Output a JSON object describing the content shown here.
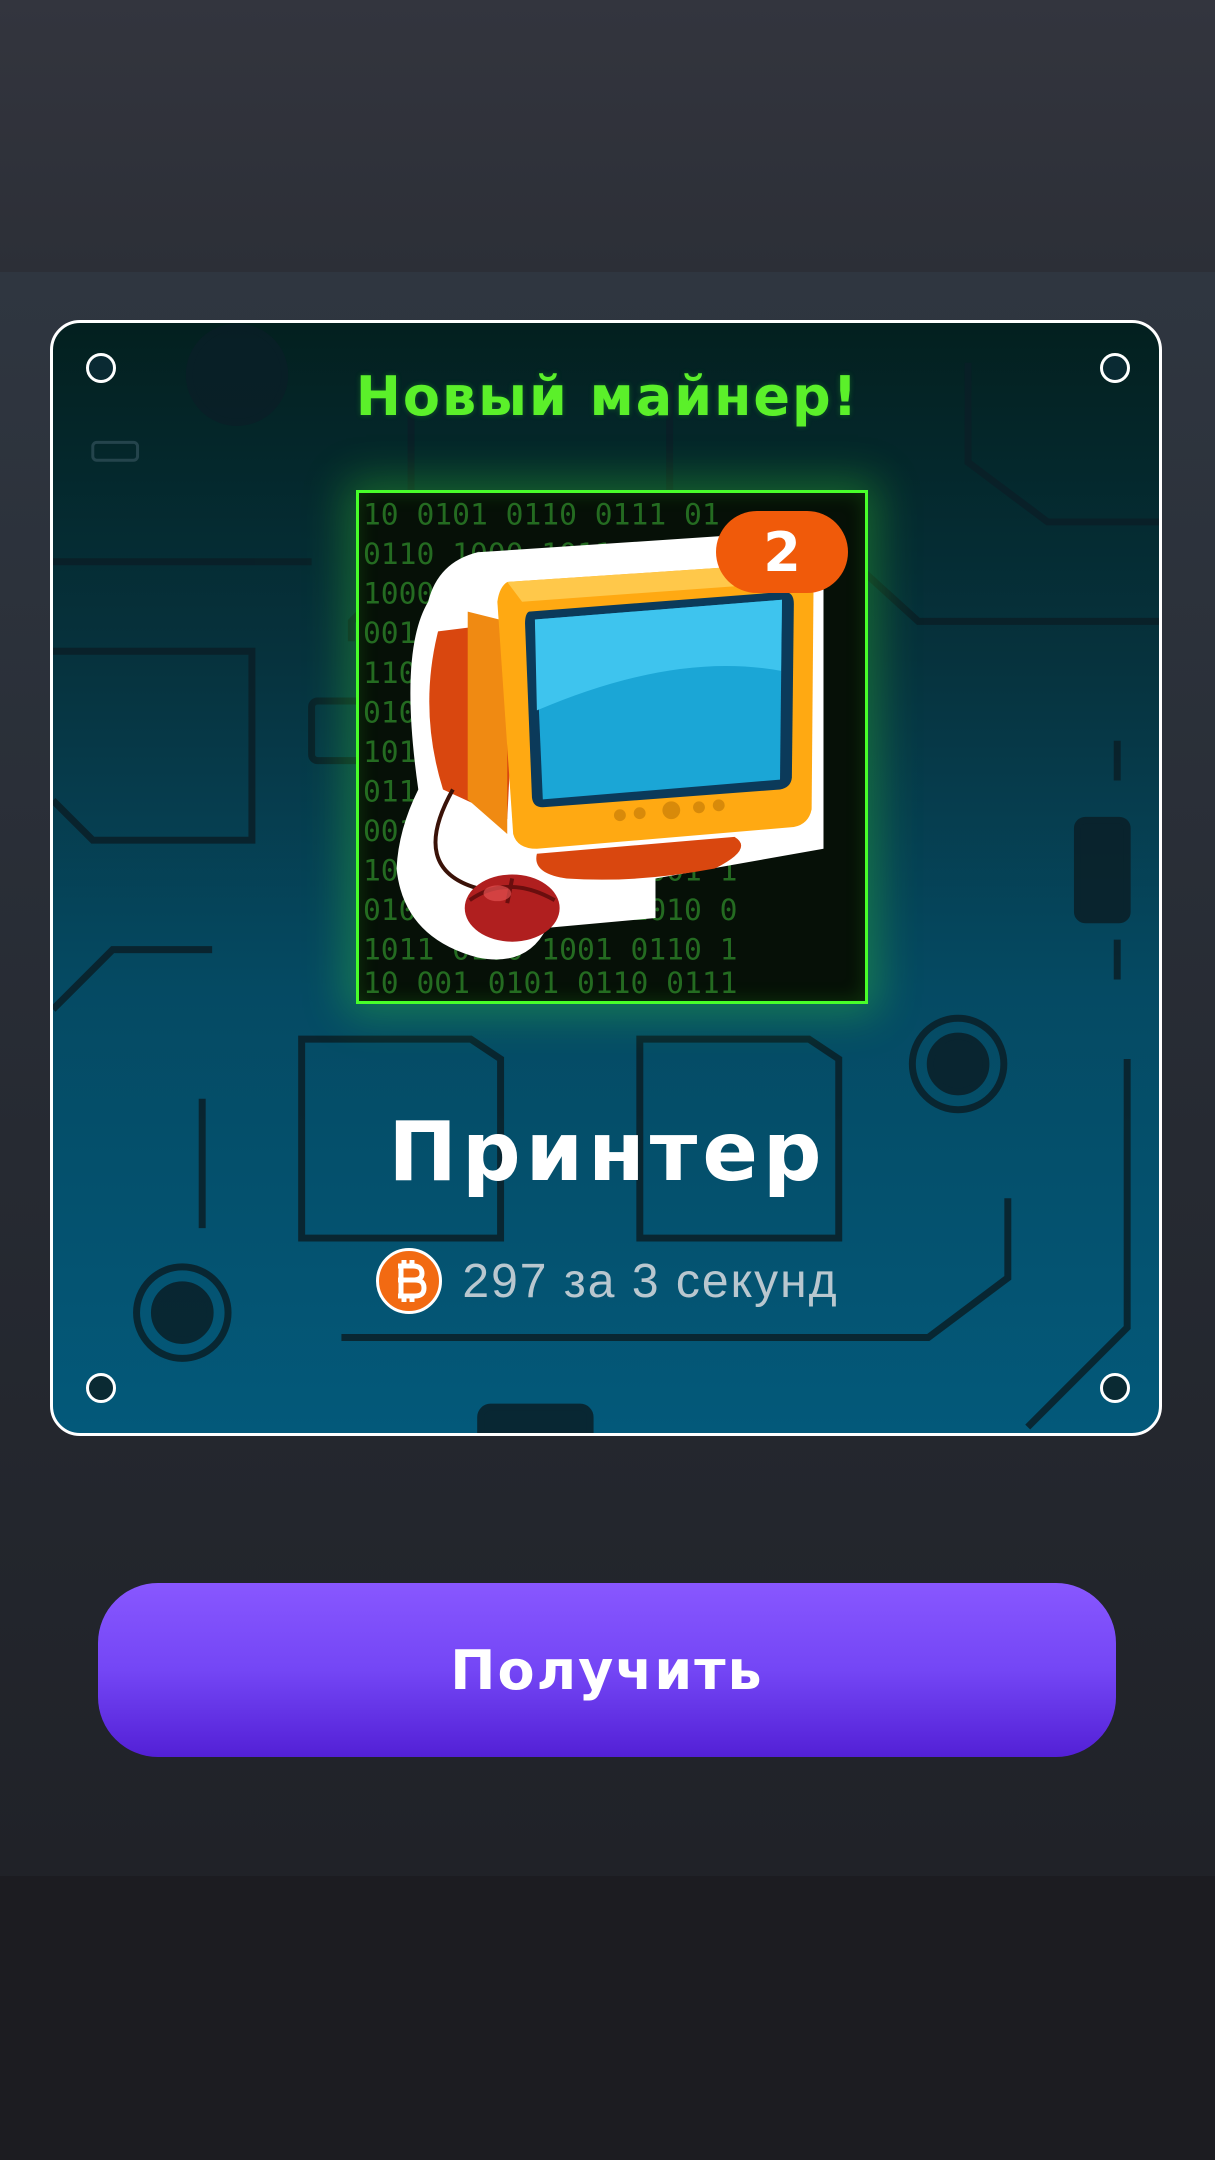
{
  "modal": {
    "title": "Новый майнер!",
    "miner_name": "Принтер",
    "level": "2",
    "rate_text": "297 за 3 секунд",
    "currency_icon": "bitcoin-icon"
  },
  "actions": {
    "claim_label": "Получить"
  },
  "colors": {
    "title_green": "#5bf02a",
    "frame_green": "#48ff2a",
    "badge_orange": "#f05a0a",
    "button_purple": "#7446f5",
    "bitcoin_orange": "#f26a12"
  }
}
